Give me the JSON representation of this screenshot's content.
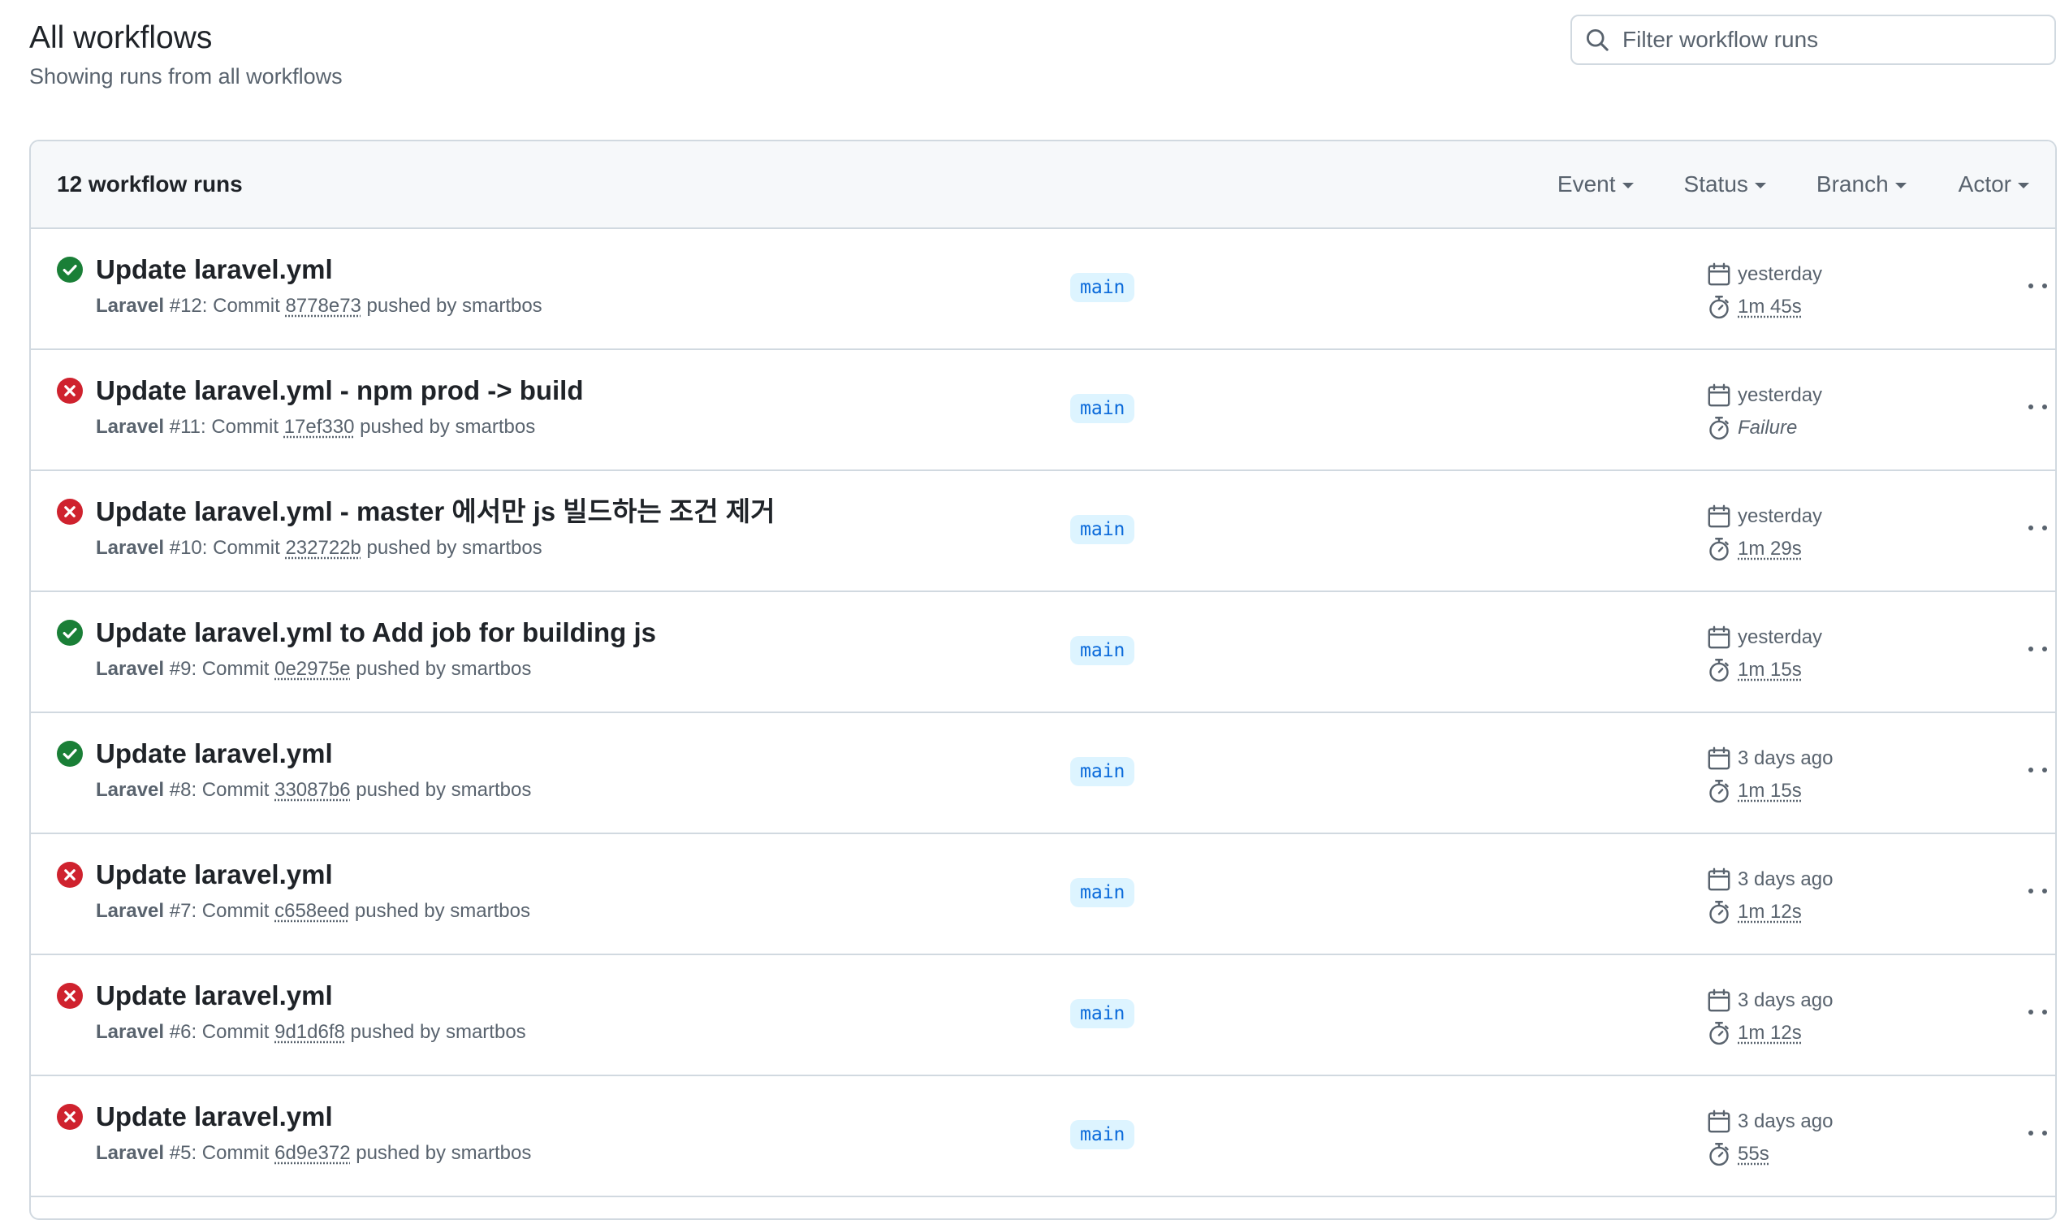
{
  "header": {
    "title": "All workflows",
    "subtitle": "Showing runs from all workflows"
  },
  "search": {
    "placeholder": "Filter workflow runs"
  },
  "runs_header": {
    "count_label": "12 workflow runs",
    "filters": [
      "Event",
      "Status",
      "Branch",
      "Actor"
    ]
  },
  "colors": {
    "success": "#1a7f37",
    "failure": "#cf222e",
    "branch_bg": "#ddf4ff",
    "branch_fg": "#0969da"
  },
  "runs": [
    {
      "status": "success",
      "title": "Update laravel.yml",
      "workflow": "Laravel",
      "number": "#12",
      "commit_prefix": ": Commit ",
      "sha": "8778e73",
      "pushed": " pushed by smartbos",
      "branch": "main",
      "date": "yesterday",
      "duration": "1m 45s"
    },
    {
      "status": "failure",
      "title": "Update laravel.yml - npm prod -> build",
      "workflow": "Laravel",
      "number": "#11",
      "commit_prefix": ": Commit ",
      "sha": "17ef330",
      "pushed": " pushed by smartbos",
      "branch": "main",
      "date": "yesterday",
      "duration": "Failure"
    },
    {
      "status": "failure",
      "title": "Update laravel.yml - master 에서만 js 빌드하는 조건 제거",
      "workflow": "Laravel",
      "number": "#10",
      "commit_prefix": ": Commit ",
      "sha": "232722b",
      "pushed": " pushed by smartbos",
      "branch": "main",
      "date": "yesterday",
      "duration": "1m 29s"
    },
    {
      "status": "success",
      "title": "Update laravel.yml to Add job for building js",
      "workflow": "Laravel",
      "number": "#9",
      "commit_prefix": ": Commit ",
      "sha": "0e2975e",
      "pushed": " pushed by smartbos",
      "branch": "main",
      "date": "yesterday",
      "duration": "1m 15s"
    },
    {
      "status": "success",
      "title": "Update laravel.yml",
      "workflow": "Laravel",
      "number": "#8",
      "commit_prefix": ": Commit ",
      "sha": "33087b6",
      "pushed": " pushed by smartbos",
      "branch": "main",
      "date": "3 days ago",
      "duration": "1m 15s"
    },
    {
      "status": "failure",
      "title": "Update laravel.yml",
      "workflow": "Laravel",
      "number": "#7",
      "commit_prefix": ": Commit ",
      "sha": "c658eed",
      "pushed": " pushed by smartbos",
      "branch": "main",
      "date": "3 days ago",
      "duration": "1m 12s"
    },
    {
      "status": "failure",
      "title": "Update laravel.yml",
      "workflow": "Laravel",
      "number": "#6",
      "commit_prefix": ": Commit ",
      "sha": "9d1d6f8",
      "pushed": " pushed by smartbos",
      "branch": "main",
      "date": "3 days ago",
      "duration": "1m 12s"
    },
    {
      "status": "failure",
      "title": "Update laravel.yml",
      "workflow": "Laravel",
      "number": "#5",
      "commit_prefix": ": Commit ",
      "sha": "6d9e372",
      "pushed": " pushed by smartbos",
      "branch": "main",
      "date": "3 days ago",
      "duration": "55s"
    }
  ]
}
